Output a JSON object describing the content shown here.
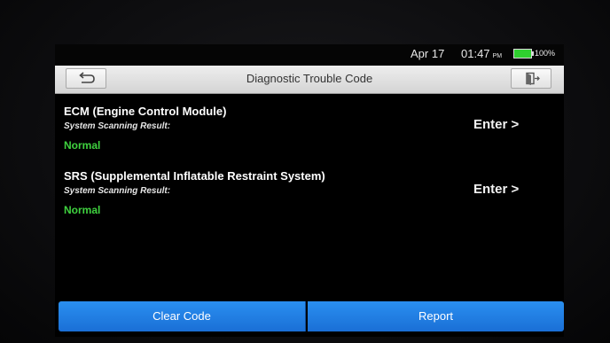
{
  "status": {
    "date": "Apr 17",
    "time": "01:47",
    "ampm": "PM",
    "battery": "100%",
    "battery_level": 1.0
  },
  "header": {
    "title": "Diagnostic Trouble Code",
    "back_icon": "back-arrow-icon",
    "exit_icon": "exit-door-icon"
  },
  "systems": [
    {
      "name": "ECM (Engine Control Module)",
      "scan_label": "System Scanning Result:",
      "status": "Normal",
      "enter_label": "Enter >"
    },
    {
      "name": "SRS (Supplemental Inflatable Restraint System)",
      "scan_label": "System Scanning Result:",
      "status": "Normal",
      "enter_label": "Enter >"
    }
  ],
  "footer": {
    "clear_label": "Clear Code",
    "report_label": "Report"
  },
  "colors": {
    "status_ok": "#3fd23f",
    "button_blue": "#1f7fe6",
    "battery": "#2fcf2f"
  }
}
